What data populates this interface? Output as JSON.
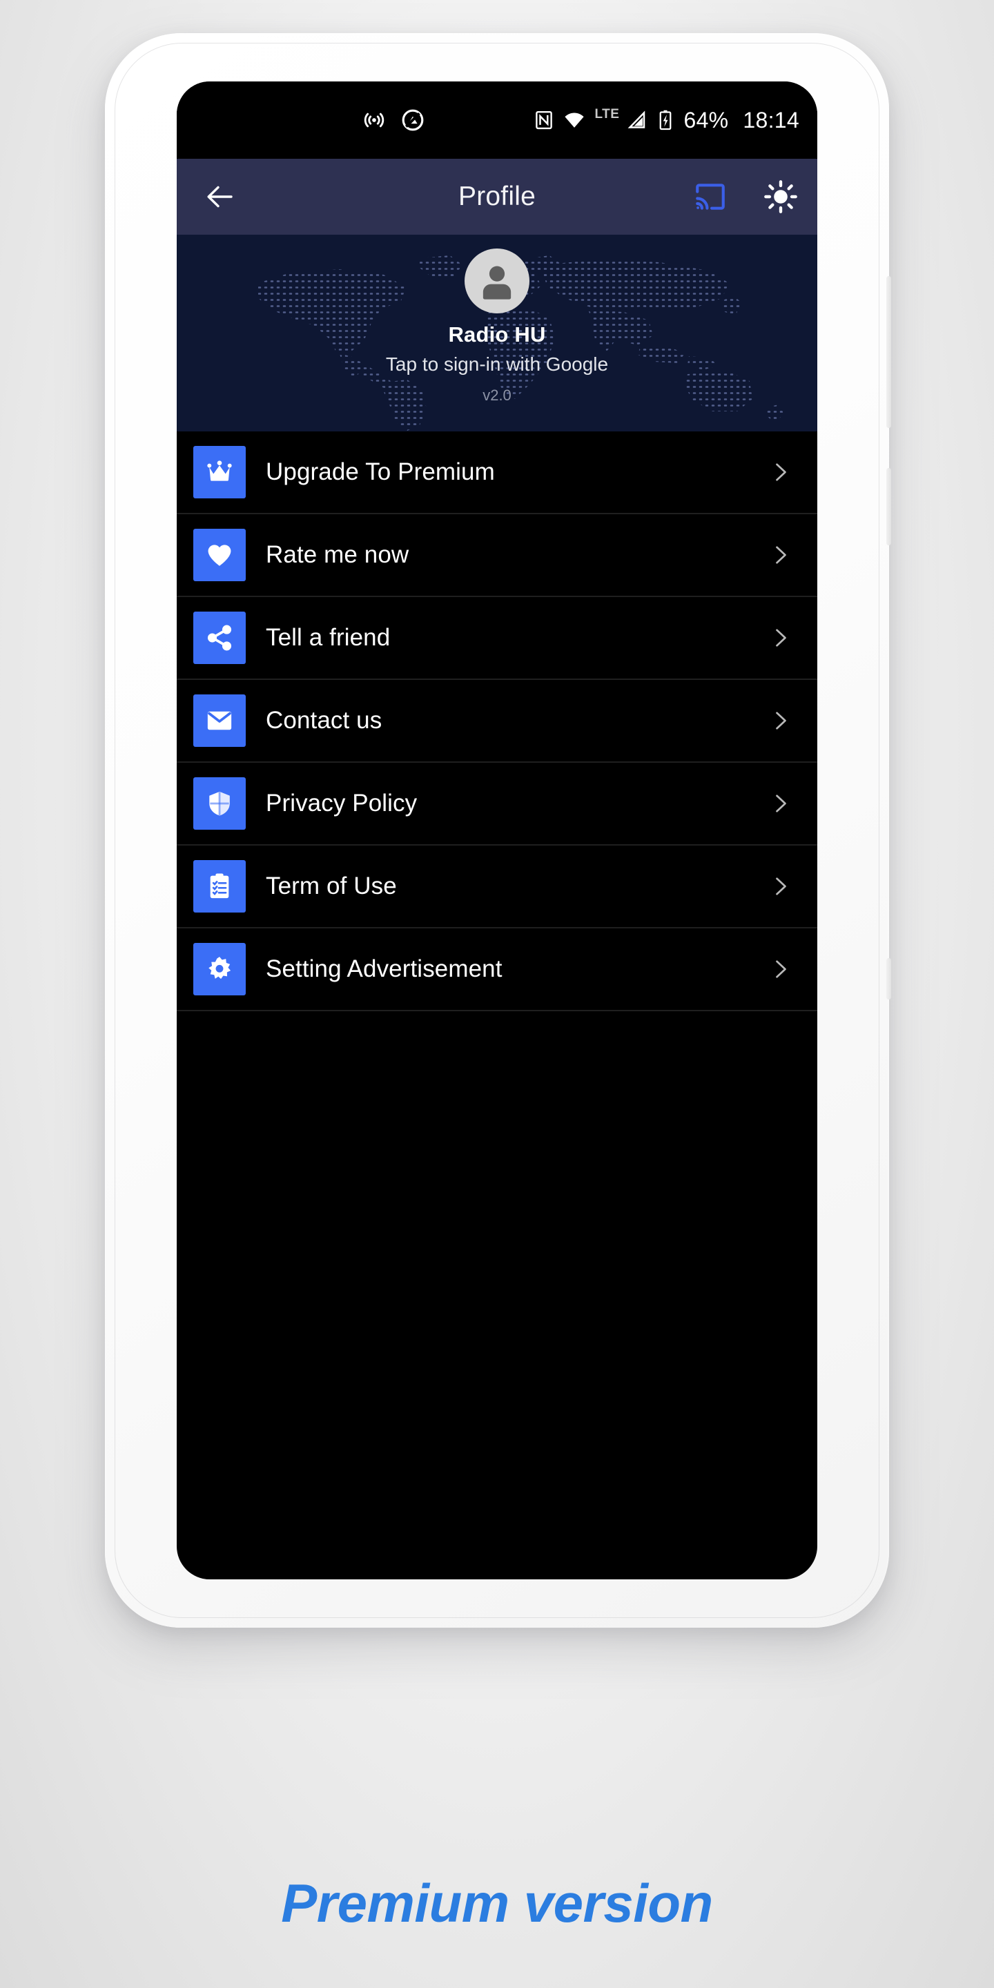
{
  "status_bar": {
    "left_icons": [
      "broadcast-icon",
      "no-silent-icon"
    ],
    "right_icons": [
      "nfc-icon",
      "wifi-icon",
      "signal-icon"
    ],
    "network_label": "LTE",
    "battery_percent": "64%",
    "clock": "18:14"
  },
  "app_bar": {
    "back_icon": "arrow-left-icon",
    "title": "Profile",
    "cast_icon": "cast-icon",
    "brightness_icon": "sun-icon"
  },
  "profile": {
    "avatar_icon": "person-avatar-icon",
    "name": "Radio HU",
    "signin_prompt": "Tap to sign-in with Google",
    "version": "v2.0"
  },
  "menu": {
    "items": [
      {
        "label": "Upgrade To Premium",
        "icon": "crown-icon"
      },
      {
        "label": "Rate me now",
        "icon": "heart-icon"
      },
      {
        "label": "Tell a friend",
        "icon": "share-icon"
      },
      {
        "label": "Contact us",
        "icon": "envelope-icon"
      },
      {
        "label": "Privacy Policy",
        "icon": "shield-icon"
      },
      {
        "label": "Term of Use",
        "icon": "clipboard-icon"
      },
      {
        "label": "Setting Advertisement",
        "icon": "gear-icon"
      }
    ],
    "chevron_icon": "chevron-right-icon"
  },
  "caption": {
    "text": "Premium version"
  },
  "colors": {
    "accent_blue": "#3b6ef6",
    "caption_blue": "#2b7de0",
    "app_bar": "#2e3152",
    "header_bg": "#0e1733",
    "screen_bg": "#000000",
    "avatar_bg": "#d6d6d6"
  }
}
